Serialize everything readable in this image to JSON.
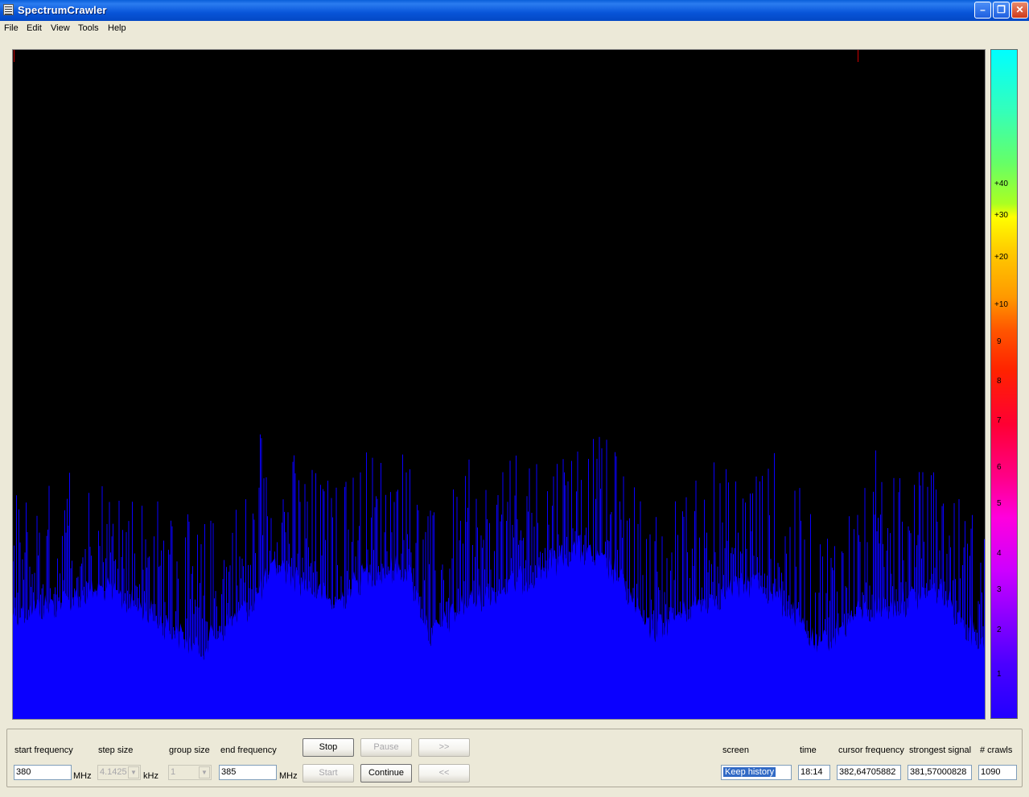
{
  "window": {
    "title": "SpectrumCrawler"
  },
  "menu": [
    "File",
    "Edit",
    "View",
    "Tools",
    "Help"
  ],
  "scale": {
    "colors": {
      "low": "#2200ff",
      "high": "#00ffff"
    },
    "ticks": [
      "+40",
      "+30",
      "+20",
      "+10",
      "9",
      "8",
      "7",
      "6",
      "5",
      "4",
      "3",
      "2",
      "1"
    ]
  },
  "controls": {
    "start_frequency": {
      "label": "start frequency",
      "value": "380",
      "unit": "MHz"
    },
    "step_size": {
      "label": "step size",
      "value": "4.1425",
      "unit": "kHz"
    },
    "group_size": {
      "label": "group size",
      "value": "1"
    },
    "end_frequency": {
      "label": "end frequency",
      "value": "385",
      "unit": "MHz"
    },
    "buttons": {
      "stop": "Stop",
      "pause": "Pause",
      "forward": ">>",
      "start": "Start",
      "continue": "Continue",
      "back": "<<"
    }
  },
  "status": {
    "screen": {
      "label": "screen",
      "value": "Keep history"
    },
    "time": {
      "label": "time",
      "value": "18:14"
    },
    "cursor_frequency": {
      "label": "cursor frequency",
      "value": "382,64705882"
    },
    "strongest_signal": {
      "label": "strongest signal",
      "value": "381,57000828"
    },
    "crawls": {
      "label": "# crawls",
      "value": "1090"
    }
  },
  "spectrum": {
    "bar_color": "#0a00ff",
    "marker_color": "#cc0000"
  }
}
